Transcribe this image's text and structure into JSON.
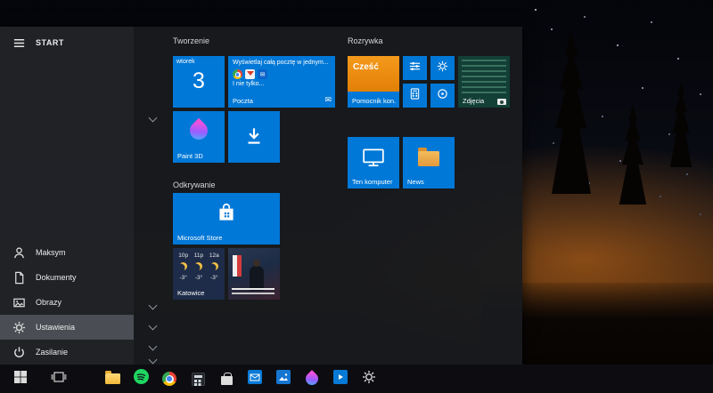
{
  "desktop": {
    "wallpaper_colors": {
      "sky": "#090b12",
      "horizon_glow": "#de761a",
      "ground": "#0a0604"
    }
  },
  "start_menu": {
    "accent_color": "#0078d7",
    "rail": {
      "menu_label": "START",
      "items": [
        {
          "label": "Maksym",
          "icon": "user-icon"
        },
        {
          "label": "Dokumenty",
          "icon": "document-icon"
        },
        {
          "label": "Obrazy",
          "icon": "image-icon"
        },
        {
          "label": "Ustawienia",
          "icon": "gear-icon",
          "highlighted": true
        },
        {
          "label": "Zasilanie",
          "icon": "power-icon"
        }
      ]
    },
    "groups": {
      "tworzenie": "Tworzenie",
      "rozrywka": "Rozrywka",
      "odkrywanie": "Odkrywanie"
    },
    "tiles": {
      "calendar": {
        "day_name": "wtorek",
        "day_number": "3"
      },
      "mail": {
        "headline": "Wyświetlaj całą pocztę w jednym...",
        "subline": "I nie tylko...",
        "label": "Poczta",
        "icon": "envelope-icon"
      },
      "paint3d": {
        "label": "Paint 3D",
        "icon": "paint-drop-icon"
      },
      "download": {
        "icon": "download-arrow-icon"
      },
      "store": {
        "label": "Microsoft Store",
        "icon": "shopping-bag-icon"
      },
      "weather": {
        "label": "Katowice",
        "cols": [
          {
            "hour": "10p",
            "temp": "-3°"
          },
          {
            "hour": "11p",
            "temp": "-3°"
          },
          {
            "hour": "12a",
            "temp": "-3°"
          }
        ]
      },
      "tips": {
        "greeting": "Cześć",
        "label": "Pomocnik kon..."
      },
      "photos": {
        "label": "Zdjęcia",
        "icon": "camera-icon"
      },
      "this_pc": {
        "label": "Ten komputer",
        "icon": "monitor-icon"
      },
      "news": {
        "label": "News",
        "icon": "folder-icon"
      }
    }
  },
  "taskbar": {
    "icons": [
      "windows-start-icon",
      "task-view-icon",
      "file-explorer-icon",
      "spotify-icon",
      "chrome-icon",
      "calculator-icon",
      "store-icon",
      "mail-icon",
      "photos-icon",
      "paint3d-icon",
      "movies-tv-icon",
      "settings-icon"
    ]
  }
}
